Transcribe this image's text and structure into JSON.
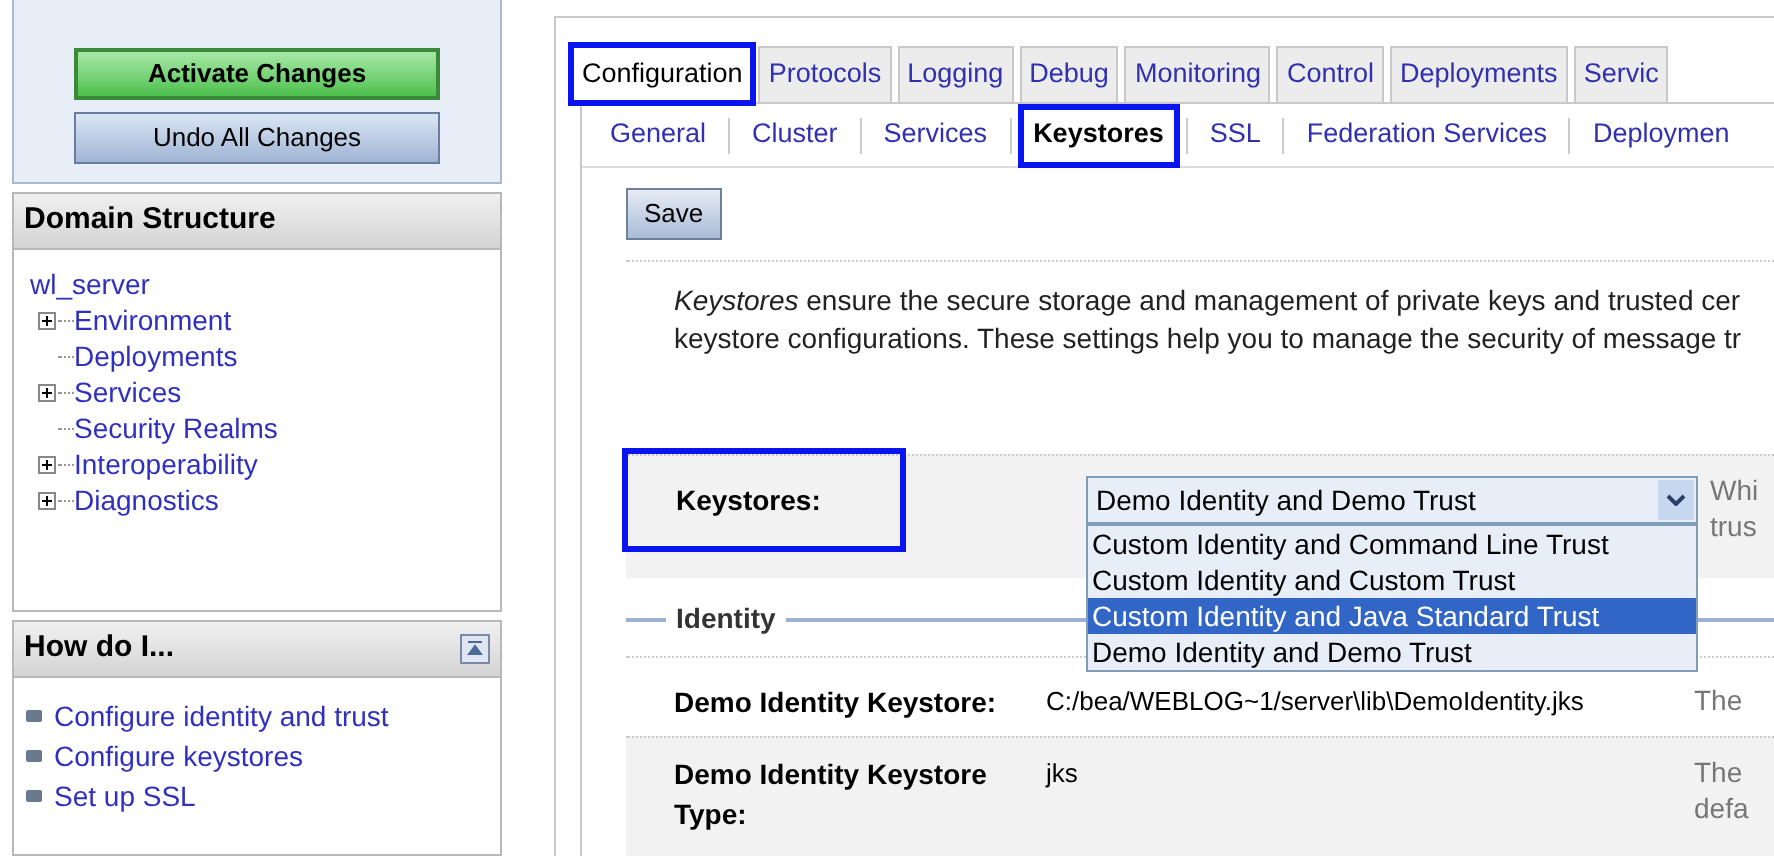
{
  "change_center": {
    "buttons": [
      {
        "label": "Activate Changes",
        "kind": "primary"
      },
      {
        "label": "Undo All Changes",
        "kind": "secondary"
      }
    ]
  },
  "domain_structure": {
    "title": "Domain Structure",
    "root": "wl_server",
    "children": [
      {
        "label": "Environment",
        "expandable": true
      },
      {
        "label": "Deployments",
        "expandable": false
      },
      {
        "label": "Services",
        "expandable": true
      },
      {
        "label": "Security Realms",
        "expandable": false
      },
      {
        "label": "Interoperability",
        "expandable": true
      },
      {
        "label": "Diagnostics",
        "expandable": true
      }
    ]
  },
  "how_do_i": {
    "title": "How do I...",
    "links": [
      "Configure identity and trust",
      "Configure keystores",
      "Set up SSL"
    ]
  },
  "tabs": [
    {
      "label": "Configuration",
      "selected": true,
      "highlighted": true
    },
    {
      "label": "Protocols",
      "selected": false,
      "highlighted": false
    },
    {
      "label": "Logging",
      "selected": false,
      "highlighted": false
    },
    {
      "label": "Debug",
      "selected": false,
      "highlighted": false
    },
    {
      "label": "Monitoring",
      "selected": false,
      "highlighted": false
    },
    {
      "label": "Control",
      "selected": false,
      "highlighted": false
    },
    {
      "label": "Deployments",
      "selected": false,
      "highlighted": false
    },
    {
      "label": "Servic",
      "selected": false,
      "highlighted": false
    }
  ],
  "subtabs": [
    {
      "label": "General",
      "selected": false,
      "highlighted": false
    },
    {
      "label": "Cluster",
      "selected": false,
      "highlighted": false
    },
    {
      "label": "Services",
      "selected": false,
      "highlighted": false
    },
    {
      "label": "Keystores",
      "selected": true,
      "highlighted": true
    },
    {
      "label": "SSL",
      "selected": false,
      "highlighted": false
    },
    {
      "label": "Federation Services",
      "selected": false,
      "highlighted": false
    },
    {
      "label": "Deploymen",
      "selected": false,
      "highlighted": false
    }
  ],
  "save_button": "Save",
  "description": [
    "*Keystores* ensure the secure storage and management of private keys and trusted cer",
    "keystore configurations. These settings help you to manage the security of message tr"
  ],
  "keystores_field": {
    "label": "Keystores:",
    "highlighted": true,
    "value": "Demo Identity and Demo Trust",
    "help": [
      "Whi",
      "trus"
    ],
    "options": [
      {
        "label": "Custom Identity and Command Line Trust",
        "highlighted": false
      },
      {
        "label": "Custom Identity and Custom Trust",
        "highlighted": false
      },
      {
        "label": "Custom Identity and Java Standard Trust",
        "highlighted": true
      },
      {
        "label": "Demo Identity and Demo Trust",
        "highlighted": false
      }
    ]
  },
  "identity_section": {
    "title": "Identity",
    "rows": [
      {
        "label": "Demo Identity Keystore:",
        "value": "C:/bea/WEBLOG~1/server\\lib\\DemoIdentity.jks",
        "help": [
          "The"
        ]
      },
      {
        "label": "Demo Identity Keystore Type:",
        "value": "jks",
        "help": [
          "The",
          "defa"
        ]
      }
    ]
  }
}
